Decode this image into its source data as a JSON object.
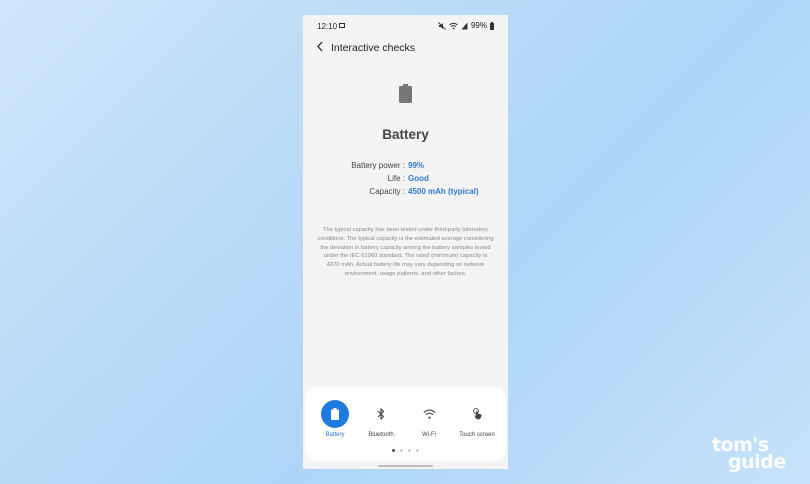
{
  "status_bar": {
    "time": "12:10",
    "battery_percent": "99%",
    "icons": [
      "image-icon",
      "mute-icon",
      "wifi-icon",
      "signal-icon",
      "battery-icon"
    ]
  },
  "header": {
    "title": "Interactive checks",
    "back_icon": "back-arrow-icon"
  },
  "battery": {
    "title": "Battery",
    "rows": [
      {
        "label": "Battery power :",
        "value": "99%"
      },
      {
        "label": "Life :",
        "value": "Good"
      },
      {
        "label": "Capacity :",
        "value": "4500 mAh (typical)"
      }
    ],
    "disclaimer": "The typical capacity has been tested under third-party laboratory conditions. The typical capacity is the estimated average considering the deviation in battery capacity among the battery samples tested under the IEC 61960 standard. The rated (minimum) capacity is 4370 mAh. Actual battery life may vary depending on network environment, usage patterns, and other factors."
  },
  "tabs": [
    {
      "label": "Battery",
      "icon": "battery-icon",
      "active": true
    },
    {
      "label": "Bluetooth",
      "icon": "bluetooth-icon",
      "active": false
    },
    {
      "label": "Wi-Fi",
      "icon": "wifi-icon",
      "active": false
    },
    {
      "label": "Touch screen",
      "icon": "touch-icon",
      "active": false
    }
  ],
  "pagination": {
    "count": 4,
    "active_index": 0
  },
  "watermark": {
    "line1": "tom's",
    "line2": "guide"
  },
  "colors": {
    "accent": "#1f7ae0",
    "value_text": "#2c7bd6",
    "background": "#f4f4f4"
  }
}
